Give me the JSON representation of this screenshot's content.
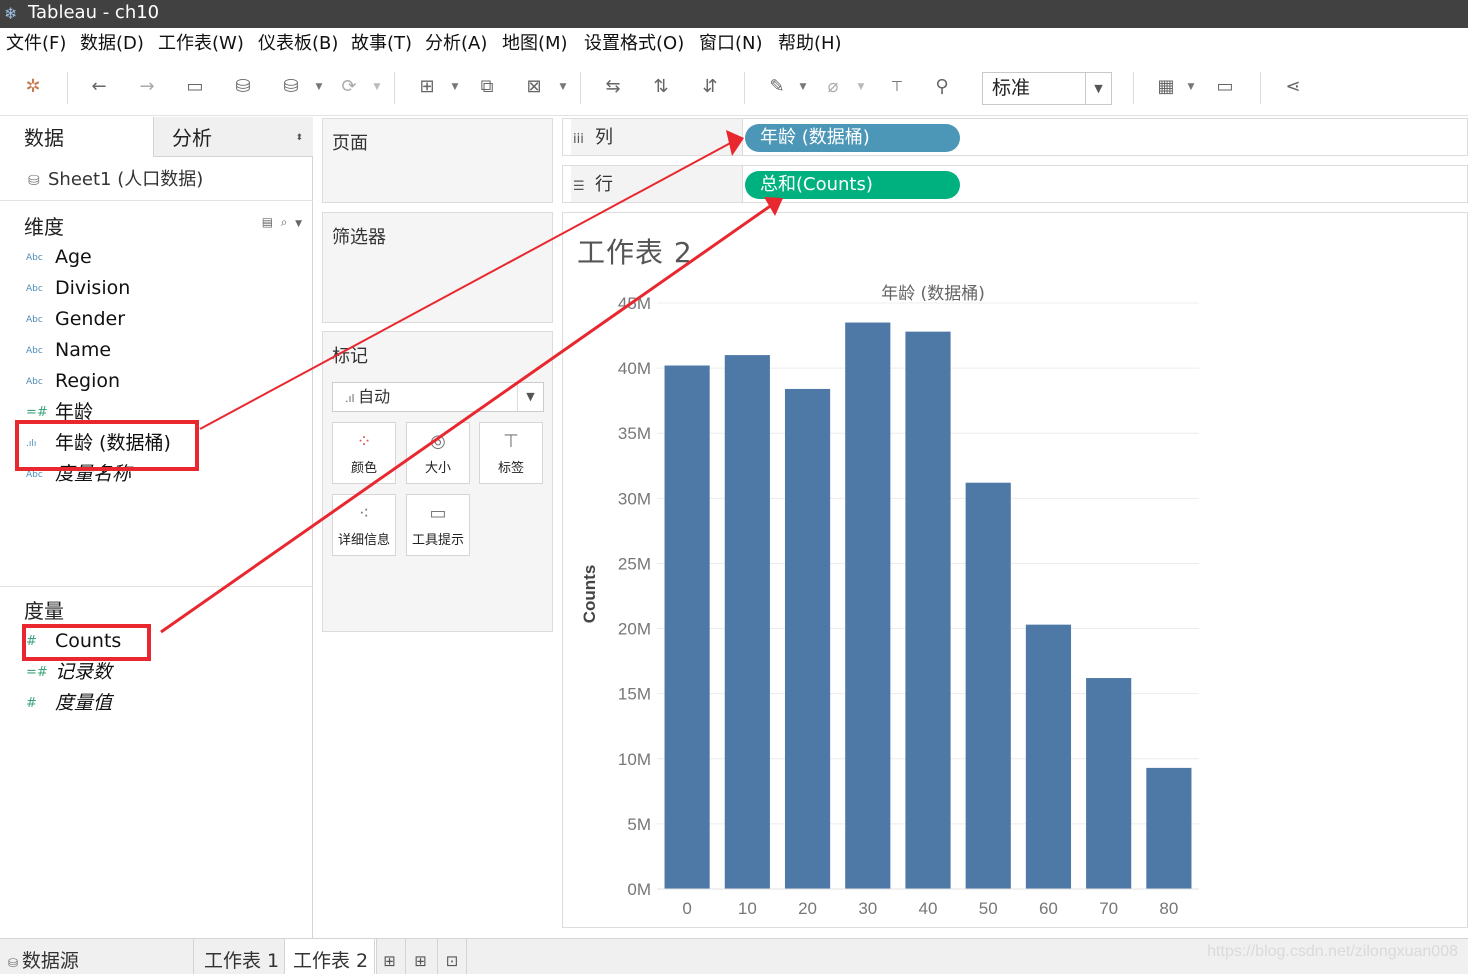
{
  "window": {
    "title": "Tableau - ch10",
    "app_icon": "tableau-logo-icon"
  },
  "menu": [
    "文件(F)",
    "数据(D)",
    "工作表(W)",
    "仪表板(B)",
    "故事(T)",
    "分析(A)",
    "地图(M)",
    "设置格式(O)",
    "窗口(N)",
    "帮助(H)"
  ],
  "toolbar": {
    "fit_select": "标准"
  },
  "data_pane": {
    "tabs": {
      "data": "数据",
      "analysis": "分析"
    },
    "datasource": "Sheet1 (人口数据)",
    "dimensions_title": "维度",
    "dimensions": [
      {
        "name": "Age",
        "icon": "Abc"
      },
      {
        "name": "Division",
        "icon": "Abc"
      },
      {
        "name": "Gender",
        "icon": "Abc"
      },
      {
        "name": "Name",
        "icon": "Abc"
      },
      {
        "name": "Region",
        "icon": "Abc"
      },
      {
        "name": "年龄",
        "icon": "=#"
      },
      {
        "name": "年龄 (数据桶)",
        "icon": ".ılı"
      },
      {
        "name": "度量名称",
        "icon": "Abc"
      }
    ],
    "measures_title": "度量",
    "measures": [
      {
        "name": "Counts",
        "icon": "#"
      },
      {
        "name": "记录数",
        "icon": "=#"
      },
      {
        "name": "度量值",
        "icon": "#"
      }
    ]
  },
  "cards": {
    "pages": "页面",
    "filters": "筛选器",
    "marks": "标记",
    "mark_type": "自动",
    "mark_buttons": [
      "颜色",
      "大小",
      "标签",
      "详细信息",
      "工具提示"
    ]
  },
  "shelves": {
    "columns": {
      "label": "列",
      "pill": "年龄 (数据桶)",
      "color": "#4c96b8"
    },
    "rows": {
      "label": "行",
      "pill": "总和(Counts)",
      "color": "#00b180"
    }
  },
  "sheet_title": "工作表 2",
  "chart_data": {
    "type": "bar",
    "title": "年龄 (数据桶)",
    "ylabel": "Counts",
    "categories": [
      "0",
      "10",
      "20",
      "30",
      "40",
      "50",
      "60",
      "70",
      "80"
    ],
    "values": [
      40.2,
      41.0,
      38.4,
      43.5,
      42.8,
      31.2,
      20.3,
      16.2,
      9.3
    ],
    "yticks": [
      "0M",
      "5M",
      "10M",
      "15M",
      "20M",
      "25M",
      "30M",
      "35M",
      "40M",
      "45M"
    ],
    "ylim": [
      0,
      45
    ],
    "bar_color": "#4e79a7",
    "grid": true
  },
  "bottom_tabs": {
    "datasource": "数据源",
    "sheets": [
      "工作表 1",
      "工作表 2"
    ]
  },
  "watermark": "https://blog.csdn.net/zilongxuan008",
  "annotation_color": "#e8282e"
}
